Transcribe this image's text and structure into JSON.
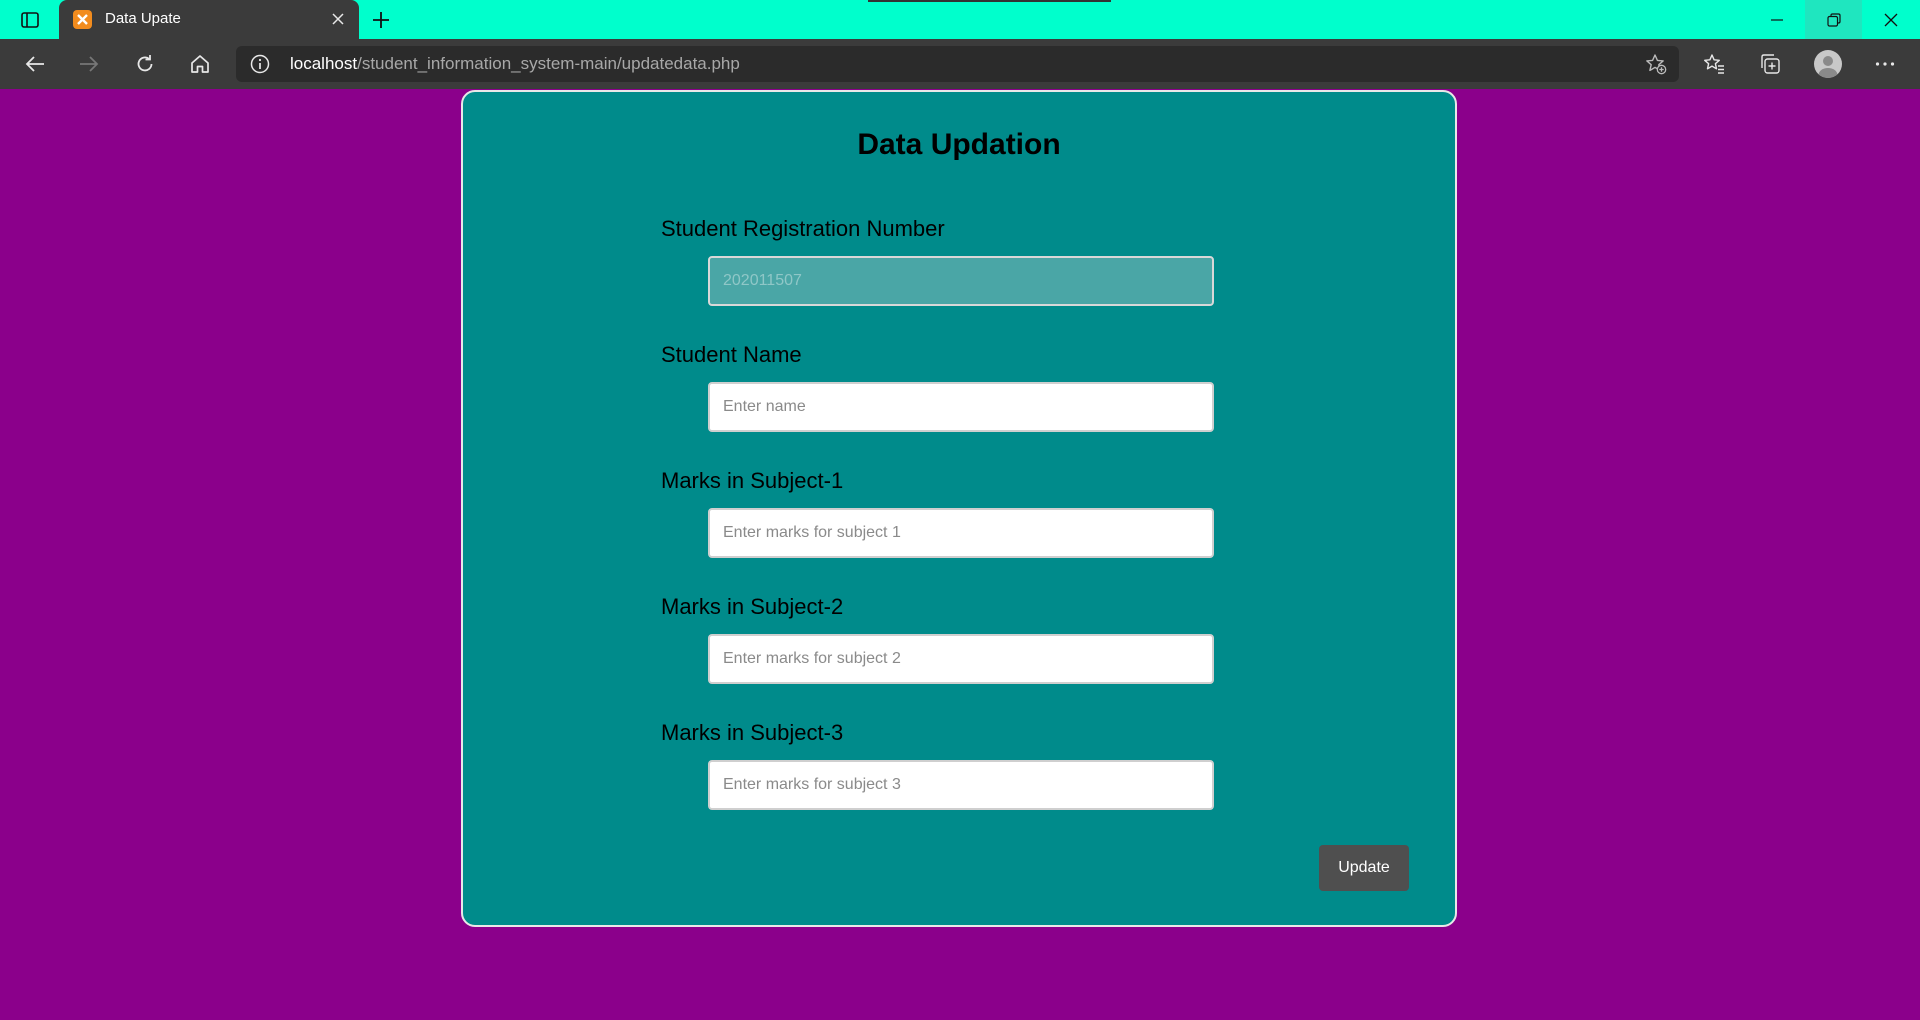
{
  "browser": {
    "tab_title": "Data Upate",
    "url_host": "localhost",
    "url_path": "/student_information_system-main/updatedata.php"
  },
  "page": {
    "title": "Data Updation",
    "fields": [
      {
        "label": "Student Registration Number",
        "placeholder": "202011507",
        "readonly": true
      },
      {
        "label": "Student Name",
        "placeholder": "Enter name",
        "readonly": false
      },
      {
        "label": "Marks in Subject-1",
        "placeholder": "Enter marks for subject 1",
        "readonly": false
      },
      {
        "label": "Marks in Subject-2",
        "placeholder": "Enter marks for subject 2",
        "readonly": false
      },
      {
        "label": "Marks in Subject-3",
        "placeholder": "Enter marks for subject 3",
        "readonly": false
      }
    ],
    "submit_label": "Update"
  },
  "colors": {
    "page_background": "#8b008b",
    "card_background": "#008b8b",
    "tabbar_background": "#00ffcc",
    "button_background": "#4f4f4f"
  },
  "icons": {
    "tab_strip": "tab-actions-icon",
    "favicon": "xampp-favicon-icon",
    "close_tab": "close-icon",
    "new_tab": "plus-icon",
    "back": "back-arrow-icon",
    "forward": "forward-arrow-icon",
    "refresh": "refresh-icon",
    "home": "home-icon",
    "site_info": "info-icon",
    "add_favorite": "star-add-icon",
    "favorites": "favorites-icon",
    "collections": "collections-icon",
    "profile": "avatar",
    "menu": "more-icon"
  }
}
